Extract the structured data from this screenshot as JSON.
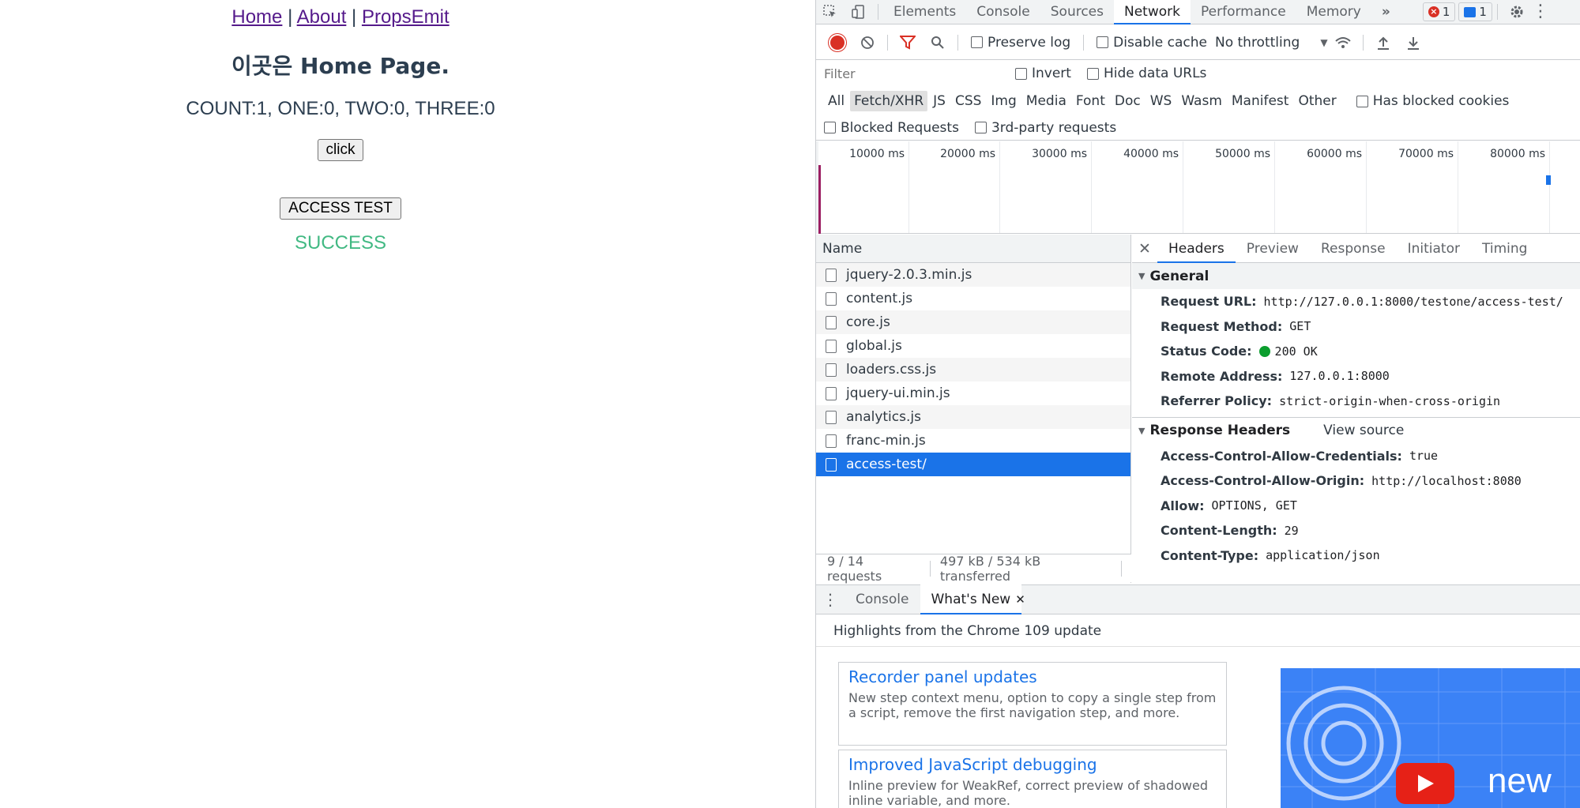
{
  "app": {
    "nav": {
      "home": "Home",
      "about": "About",
      "props_emit": "PropsEmit",
      "separator": "|"
    },
    "heading": "이곳은 Home Page.",
    "counts": "COUNT:1, ONE:0, TWO:0, THREE:0",
    "click_button": "click",
    "access_button": "ACCESS TEST",
    "result": "SUCCESS"
  },
  "devtools": {
    "tabs": [
      "Elements",
      "Console",
      "Sources",
      "Network",
      "Performance",
      "Memory"
    ],
    "active_tab": "Network",
    "more_tabs_icon": "»",
    "error_count": "1",
    "message_count": "1",
    "toolbar": {
      "preserve_log": "Preserve log",
      "disable_cache": "Disable cache",
      "throttling": "No throttling"
    },
    "filter": {
      "placeholder": "Filter",
      "invert": "Invert",
      "hide_data_urls": "Hide data URLs"
    },
    "type_filters": [
      "All",
      "Fetch/XHR",
      "JS",
      "CSS",
      "Img",
      "Media",
      "Font",
      "Doc",
      "WS",
      "Wasm",
      "Manifest",
      "Other"
    ],
    "active_type": "Fetch/XHR",
    "has_blocked_cookies": "Has blocked cookies",
    "blocked_requests": "Blocked Requests",
    "third_party": "3rd-party requests",
    "timeline_labels": [
      "10000 ms",
      "20000 ms",
      "30000 ms",
      "40000 ms",
      "50000 ms",
      "60000 ms",
      "70000 ms",
      "80000 ms"
    ],
    "requests": {
      "header": "Name",
      "items": [
        "jquery-2.0.3.min.js",
        "content.js",
        "core.js",
        "global.js",
        "loaders.css.js",
        "jquery-ui.min.js",
        "analytics.js",
        "franc-min.js",
        "access-test/"
      ],
      "selected": "access-test/",
      "summary_count": "9 / 14 requests",
      "summary_size": "497 kB / 534 kB transferred"
    },
    "detail_tabs": [
      "Headers",
      "Preview",
      "Response",
      "Initiator",
      "Timing"
    ],
    "active_detail_tab": "Headers",
    "general": {
      "title": "General",
      "rows": [
        {
          "key": "Request URL:",
          "value": "http://127.0.0.1:8000/testone/access-test/"
        },
        {
          "key": "Request Method:",
          "value": "GET"
        },
        {
          "key": "Status Code:",
          "value": "200 OK"
        },
        {
          "key": "Remote Address:",
          "value": "127.0.0.1:8000"
        },
        {
          "key": "Referrer Policy:",
          "value": "strict-origin-when-cross-origin"
        }
      ]
    },
    "response_headers": {
      "title": "Response Headers",
      "view_source": "View source",
      "rows": [
        {
          "key": "Access-Control-Allow-Credentials:",
          "value": "true"
        },
        {
          "key": "Access-Control-Allow-Origin:",
          "value": "http://localhost:8080"
        },
        {
          "key": "Allow:",
          "value": "OPTIONS, GET"
        },
        {
          "key": "Content-Length:",
          "value": "29"
        },
        {
          "key": "Content-Type:",
          "value": "application/json"
        }
      ]
    },
    "drawer": {
      "tabs": [
        "Console",
        "What's New"
      ],
      "active": "What's New",
      "highlights": "Highlights from the Chrome 109 update",
      "cards": [
        {
          "title": "Recorder panel updates",
          "desc": "New step context menu, option to copy a single step from a script, remove the first navigation step, and more."
        },
        {
          "title": "Improved JavaScript debugging",
          "desc": "Inline preview for WeakRef, correct preview of shadowed inline variable, and more."
        }
      ],
      "video_text": "new"
    },
    "colors": {
      "accent": "#1a73e8",
      "record": "#d93025",
      "success": "#42b983",
      "status_ok": "#0b9e2e"
    }
  }
}
